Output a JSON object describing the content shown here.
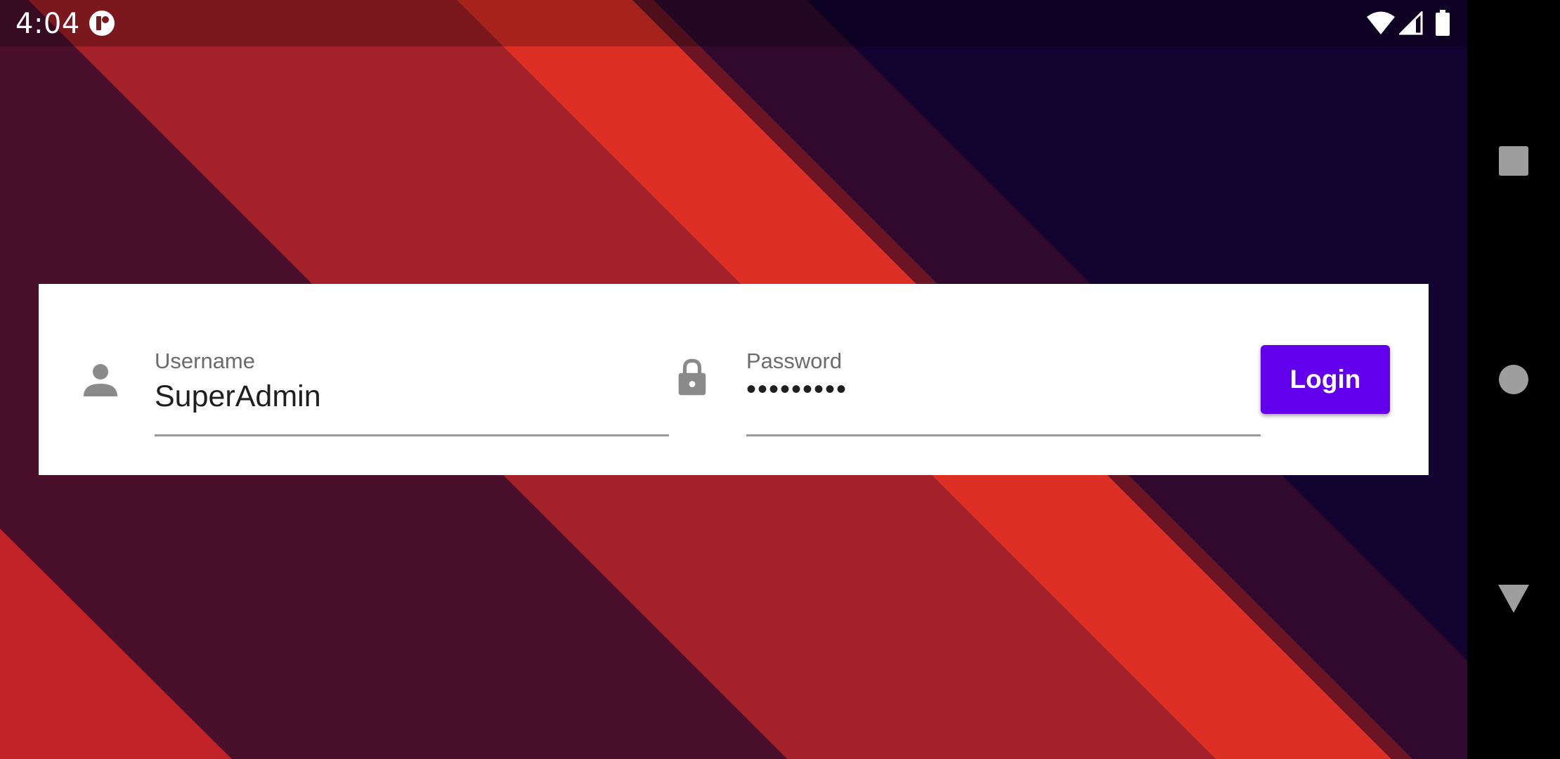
{
  "status_bar": {
    "time": "4:04",
    "icons": [
      "app-notification-icon",
      "wifi-icon",
      "cell-signal-icon",
      "battery-icon"
    ]
  },
  "login_form": {
    "username": {
      "label": "Username",
      "value": "SuperAdmin",
      "icon": "person-icon"
    },
    "password": {
      "label": "Password",
      "value": "•••••••••",
      "icon": "lock-icon"
    },
    "login_button_label": "Login"
  },
  "nav_bar": {
    "buttons": [
      "recents-square-icon",
      "home-circle-icon",
      "back-triangle-icon"
    ]
  },
  "colors": {
    "accent": "#6200ee",
    "background_dark_purple": "#4a102b",
    "background_navy": "#130330",
    "stripe_red": "#a32128",
    "stripe_bright_red": "#dc2f24",
    "icon_gray": "#8a8a8a"
  }
}
